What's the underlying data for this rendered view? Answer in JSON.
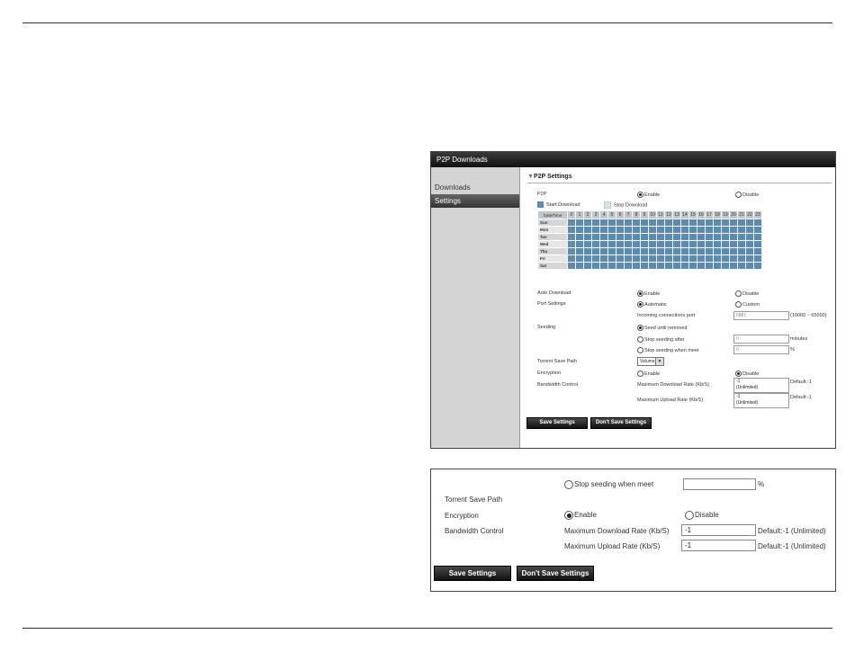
{
  "panel": {
    "title": "P2P Downloads",
    "sidebar": [
      {
        "label": "Downloads",
        "active": false
      },
      {
        "label": "Settings",
        "active": true
      }
    ],
    "section_title": "P2P Settings",
    "p2p": {
      "label": "P2P",
      "enable": "Enable",
      "disable": "Disable",
      "selected": "enable"
    },
    "legend": {
      "start": "Start Download",
      "stop": "Stop Download"
    },
    "schedule": {
      "corner": "Date/Time",
      "hours": [
        "0",
        "1",
        "2",
        "3",
        "4",
        "5",
        "6",
        "7",
        "8",
        "9",
        "10",
        "11",
        "12",
        "13",
        "14",
        "15",
        "16",
        "17",
        "18",
        "19",
        "20",
        "21",
        "22",
        "23"
      ],
      "days": [
        "Sun",
        "Mon",
        "Tue",
        "Wed",
        "Thu",
        "Fri",
        "Sat"
      ]
    },
    "auto_download": {
      "label": "Auto Download",
      "enable": "Enable",
      "disable": "Disable",
      "selected": "enable"
    },
    "port": {
      "label": "Port Settings",
      "automatic": "Automatic",
      "custom": "Custom",
      "selected": "automatic",
      "incoming_label": "Incoming connections port",
      "incoming_value": "6881",
      "range": "(10000 ~ 65000)"
    },
    "seeding": {
      "label": "Seeding",
      "opt1": "Seed until removed",
      "opt2": "Stop seeding after",
      "opt3": "Stop seeding when meet",
      "after_value": "0",
      "after_unit": "minutes",
      "meet_value": "0",
      "meet_unit": "%",
      "selected": "opt1"
    },
    "save_path": {
      "label": "Torrent Save Path",
      "value": "Volume_1"
    },
    "encryption": {
      "label": "Encryption",
      "enable": "Enable",
      "disable": "Disable",
      "selected": "disable"
    },
    "bandwidth": {
      "label": "Bandwidth Control",
      "down_label": "Maximum Download Rate (Kb/S)",
      "down_value": "-1",
      "down_sub": "(Unlimited)",
      "down_default": "Default:-1",
      "up_label": "Maximum Upload Rate (Kb/S)",
      "up_value": "-1",
      "up_sub": "(Unlimited)",
      "up_default": "Default:-1"
    },
    "buttons": {
      "save": "Save Settings",
      "dont_save": "Don't Save Settings"
    }
  },
  "zoom": {
    "meet_label": "Stop seeding when meet",
    "meet_value": "",
    "meet_unit": "%",
    "save_path_label": "Torrent Save Path",
    "encryption_label": "Encryption",
    "enable": "Enable",
    "disable": "Disable",
    "encryption_selected": "enable",
    "bandwidth_label": "Bandwidth Control",
    "down_label": "Maximum Download Rate (Kb/S)",
    "down_value": "-1",
    "down_default": "Default:-1 (Unlimited)",
    "up_label": "Maximum Upload Rate (Kb/S)",
    "up_value": "-1",
    "up_default": "Default:-1 (Unlimited)",
    "save": "Save Settings",
    "dont_save": "Don't Save Settings"
  },
  "colors": {
    "schedule_on": "#5b8bb0",
    "schedule_off": "#d8e2ea",
    "accent": "#3a7ebf"
  }
}
